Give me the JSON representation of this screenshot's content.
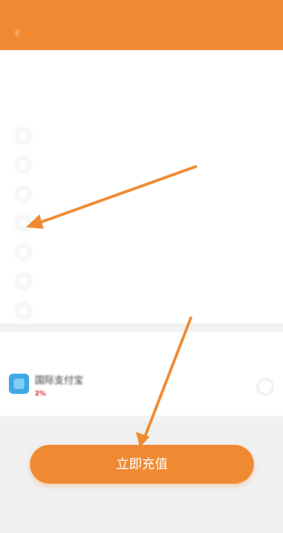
{
  "status_bar": {
    "left": "",
    "right": ""
  },
  "header": {
    "back_icon": "chevron-left-icon",
    "title": "",
    "color": "#f08a32"
  },
  "amount_section": {
    "title": "",
    "notice": "",
    "columns": [
      "",
      ""
    ],
    "rows": [
      {
        "amount": "",
        "range": ""
      },
      {
        "amount": "",
        "range": ""
      },
      {
        "amount": "",
        "range": ""
      },
      {
        "amount": "",
        "range": ""
      },
      {
        "amount": "",
        "range": ""
      },
      {
        "amount": "",
        "range": ""
      },
      {
        "amount": "",
        "range": ""
      }
    ]
  },
  "payment_section": {
    "title": "",
    "method": "国际支付宝",
    "fee_prefix": "",
    "fee_percent": "2%",
    "fee_suffix": "",
    "icon": "alipay-icon",
    "color": "#3fa9e8"
  },
  "submit_button": {
    "label": "立即充值",
    "color": "#f08a32"
  },
  "annotations": {
    "arrow_color": "#f08a32"
  }
}
